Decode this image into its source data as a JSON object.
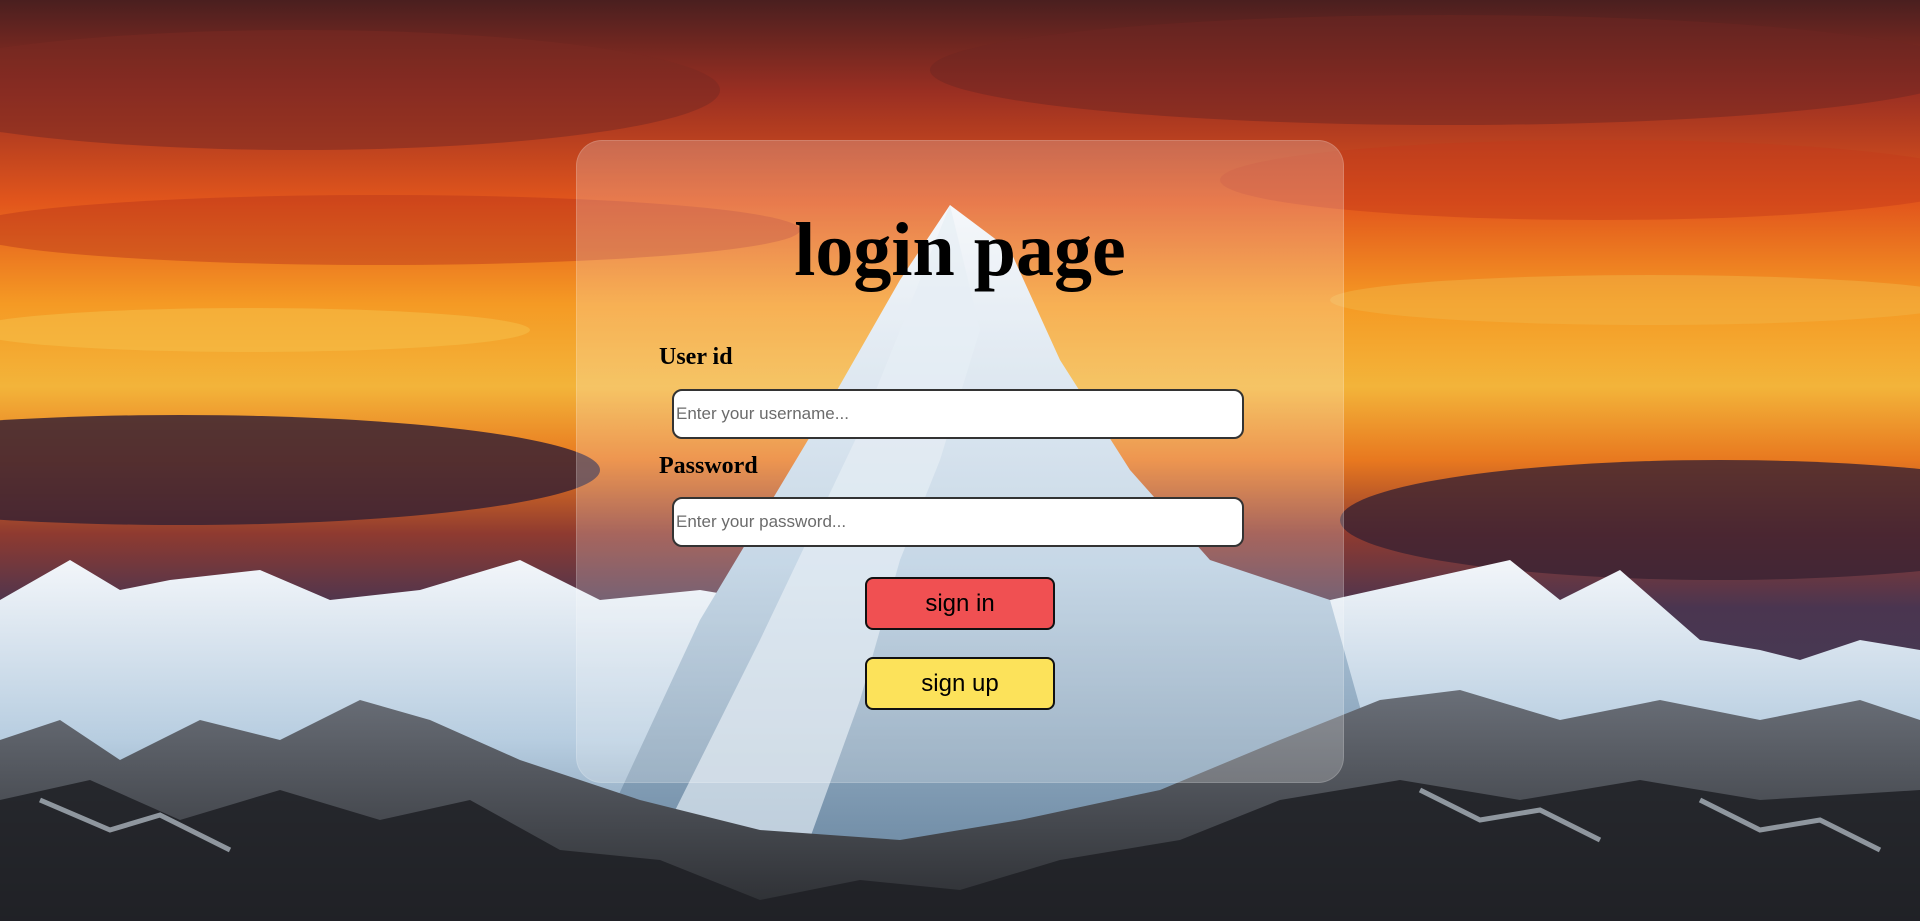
{
  "page": {
    "title": "login page"
  },
  "form": {
    "user_label": "User id",
    "user_placeholder": "Enter your username...",
    "password_label": "Password",
    "password_placeholder": "Enter your password...",
    "signin_label": "sign in",
    "signup_label": "sign up"
  },
  "colors": {
    "signin_bg": "#f05052",
    "signup_bg": "#fce25a",
    "card_bg": "rgba(255,255,255,0.22)"
  }
}
